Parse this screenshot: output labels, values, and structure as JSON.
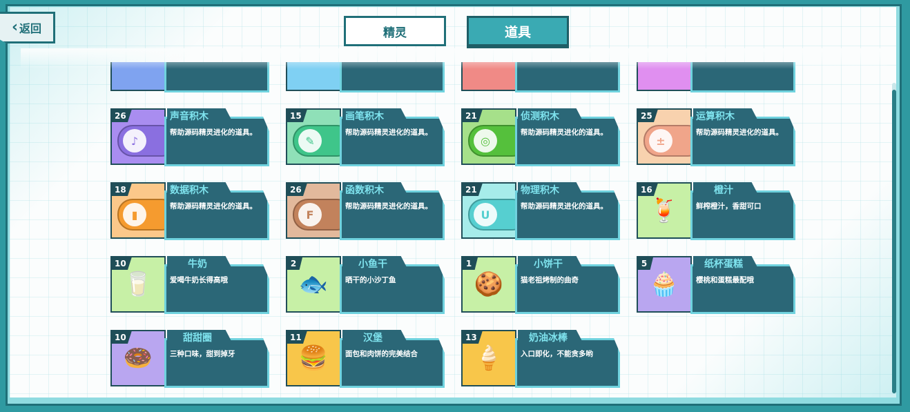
{
  "nav": {
    "back_label": "返回"
  },
  "tabs": [
    {
      "label": "精灵",
      "active": false
    },
    {
      "label": "道具",
      "active": true
    }
  ],
  "partial_row": [
    {
      "color": "#7fa3f0"
    },
    {
      "color": "#7fd0f3"
    },
    {
      "color": "#f08a86"
    },
    {
      "color": "#e08ff0"
    }
  ],
  "items": [
    {
      "count": "26",
      "name": "声音积木",
      "desc": "帮助源码精灵进化的道具。",
      "bg": "#a98df0",
      "color": "#8a6fe0",
      "icon": "microphone-icon",
      "glyph": "♪"
    },
    {
      "count": "15",
      "name": "画笔积木",
      "desc": "帮助源码精灵进化的道具。",
      "bg": "#8fe0b8",
      "color": "#3fc58a",
      "icon": "pen-icon",
      "glyph": "✎"
    },
    {
      "count": "21",
      "name": "侦测积木",
      "desc": "帮助源码精灵进化的道具。",
      "bg": "#a6e08a",
      "color": "#55c03c",
      "icon": "sensing-icon",
      "glyph": "◎"
    },
    {
      "count": "25",
      "name": "运算积木",
      "desc": "帮助源码精灵进化的道具。",
      "bg": "#f8d2ae",
      "color": "#f0a58a",
      "icon": "operator-icon",
      "glyph": "±"
    },
    {
      "count": "18",
      "name": "数据积木",
      "desc": "帮助源码精灵进化的道具。",
      "bg": "#fbc88a",
      "color": "#f59b2f",
      "icon": "data-icon",
      "glyph": "▮"
    },
    {
      "count": "26",
      "name": "函数积木",
      "desc": "帮助源码精灵进化的道具。",
      "bg": "#e2b99c",
      "color": "#c2825c",
      "icon": "function-icon",
      "glyph": "F"
    },
    {
      "count": "21",
      "name": "物理积木",
      "desc": "帮助源码精灵进化的道具。",
      "bg": "#a6ecea",
      "color": "#56cfd0",
      "icon": "physics-icon",
      "glyph": "U"
    },
    {
      "count": "16",
      "name": "橙汁",
      "desc": "鲜榨橙汁，香甜可口",
      "bg": "#c7f0a6",
      "color": "",
      "icon": "orange-juice-icon",
      "glyph": "🍹"
    },
    {
      "count": "10",
      "name": "牛奶",
      "desc": "爱喝牛奶长得高哦",
      "bg": "#c7f0a6",
      "color": "",
      "icon": "milk-icon",
      "glyph": "🥛"
    },
    {
      "count": "2",
      "name": "小鱼干",
      "desc": "晒干的小沙丁鱼",
      "bg": "#c7f0a6",
      "color": "",
      "icon": "dried-fish-icon",
      "glyph": "🐟"
    },
    {
      "count": "1",
      "name": "小饼干",
      "desc": "猫老祖烤制的曲奇",
      "bg": "#c7f0a6",
      "color": "",
      "icon": "cookie-icon",
      "glyph": "🍪"
    },
    {
      "count": "5",
      "name": "纸杯蛋糕",
      "desc": "樱桃和蛋糕最配哦",
      "bg": "#b9a6f0",
      "color": "",
      "icon": "cupcake-icon",
      "glyph": "🧁"
    },
    {
      "count": "10",
      "name": "甜甜圈",
      "desc": "三种口味，甜到掉牙",
      "bg": "#b9a6f0",
      "color": "",
      "icon": "donut-icon",
      "glyph": "🍩"
    },
    {
      "count": "11",
      "name": "汉堡",
      "desc": "面包和肉饼的完美结合",
      "bg": "#f8c64a",
      "color": "",
      "icon": "burger-icon",
      "glyph": "🍔"
    },
    {
      "count": "13",
      "name": "奶油冰棒",
      "desc": "入口即化，不能贪多哟",
      "bg": "#f8c64a",
      "color": "",
      "icon": "popsicle-icon",
      "glyph": "🍦"
    }
  ]
}
